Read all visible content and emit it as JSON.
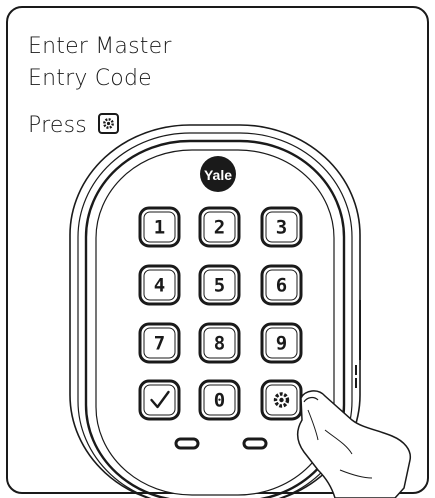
{
  "instructions": {
    "line1": "Enter Master",
    "line2": "Entry Code",
    "line3": "Press"
  },
  "brand": {
    "logo_text": "Yale"
  },
  "keypad": {
    "keys": [
      {
        "label": "1",
        "kind": "digit"
      },
      {
        "label": "2",
        "kind": "digit"
      },
      {
        "label": "3",
        "kind": "digit"
      },
      {
        "label": "4",
        "kind": "digit"
      },
      {
        "label": "5",
        "kind": "digit"
      },
      {
        "label": "6",
        "kind": "digit"
      },
      {
        "label": "7",
        "kind": "digit"
      },
      {
        "label": "8",
        "kind": "digit"
      },
      {
        "label": "9",
        "kind": "digit"
      },
      {
        "label": "",
        "kind": "check-icon"
      },
      {
        "label": "0",
        "kind": "digit"
      },
      {
        "label": "",
        "kind": "gear-icon"
      }
    ]
  },
  "colors": {
    "ink": "#1a1a1a",
    "panel": "#ffffff"
  }
}
